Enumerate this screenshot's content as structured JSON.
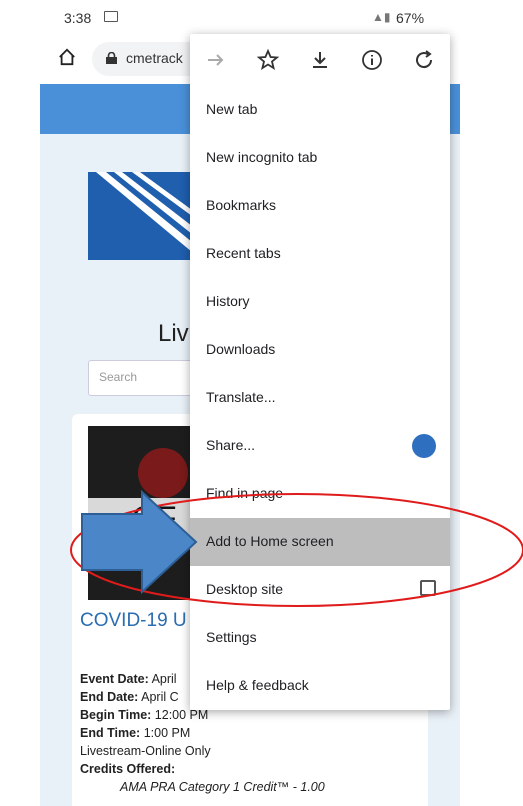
{
  "status_bar": {
    "time": "3:38",
    "battery": "67%"
  },
  "browser": {
    "url": "cmetrack",
    "menu": {
      "toolbar_icons": [
        "forward-icon",
        "star-icon",
        "download-icon",
        "info-icon",
        "refresh-icon"
      ],
      "items": [
        {
          "label": "New tab"
        },
        {
          "label": "New incognito tab"
        },
        {
          "label": "Bookmarks"
        },
        {
          "label": "Recent tabs"
        },
        {
          "label": "History"
        },
        {
          "label": "Downloads"
        },
        {
          "label": "Translate..."
        },
        {
          "label": "Share..."
        },
        {
          "label": "Find in page"
        },
        {
          "label": "Add to Home screen",
          "highlighted": true
        },
        {
          "label": "Desktop site",
          "checkbox": false
        },
        {
          "label": "Settings"
        },
        {
          "label": "Help & feedback"
        }
      ]
    }
  },
  "page": {
    "heading": "Liv",
    "search_placeholder": "Search",
    "card": {
      "image_text": "OF",
      "title": "COVID-19 U",
      "details": {
        "event_date_label": "Event Date:",
        "event_date": "April",
        "end_date_label": "End Date:",
        "end_date": "April C",
        "begin_time_label": "Begin Time:",
        "begin_time": "12:00 PM",
        "end_time_label": "End Time:",
        "end_time": "1:00 PM",
        "format": "Livestream-Online Only",
        "credits_label": "Credits Offered:",
        "credit_line": "AMA PRA Category 1 Credit™ - 1.00"
      }
    }
  },
  "annotation": {
    "arrow_color": "#4a86c8",
    "ellipse_color": "#e01b1b"
  }
}
